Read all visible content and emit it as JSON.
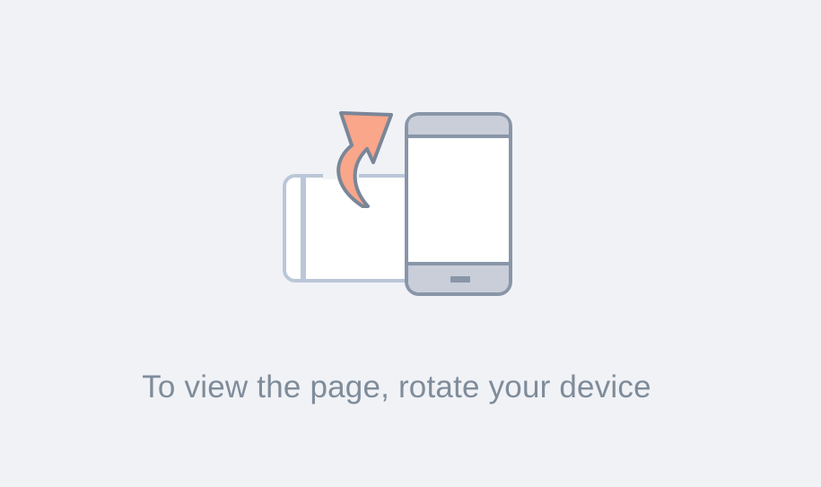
{
  "message": "To view the page, rotate your device",
  "icons": {
    "illustration": "rotate-device-illustration",
    "landscape_phone": "landscape-phone-icon",
    "portrait_phone": "portrait-phone-icon",
    "arrow": "curved-rotate-arrow-icon"
  },
  "colors": {
    "background": "#f0f2f6",
    "text": "#7f8c9a",
    "phone_outline": "#8996a8",
    "phone_band": "#c9ced9",
    "faded_phone_outline": "#bac7d8",
    "screen": "#ffffff",
    "arrow_fill": "#f9a68a",
    "arrow_outline": "#7a8698"
  }
}
